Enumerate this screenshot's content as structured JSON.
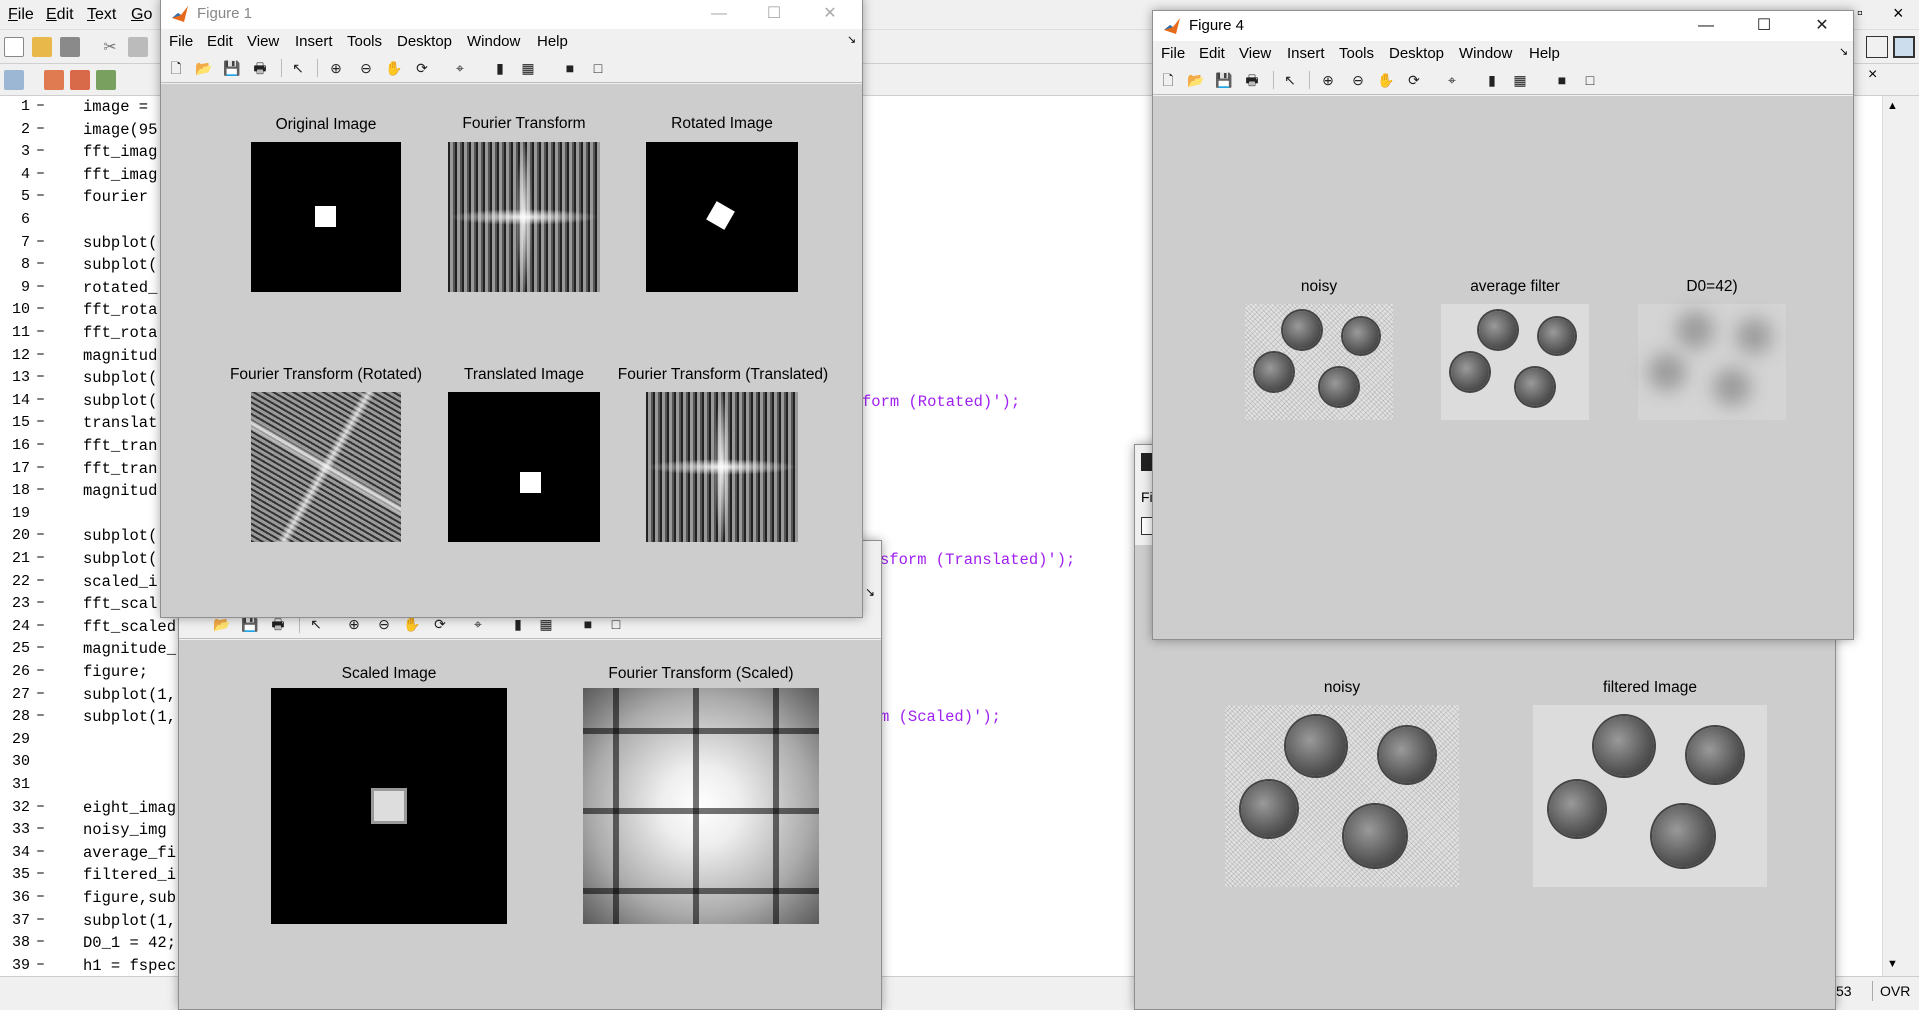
{
  "editor": {
    "menu": [
      "File",
      "Edit",
      "Text",
      "Go"
    ],
    "lines": [
      {
        "n": "1",
        "code": "image ="
      },
      {
        "n": "2",
        "code": "image(95"
      },
      {
        "n": "3",
        "code": "fft_imag"
      },
      {
        "n": "4",
        "code": "fft_imag"
      },
      {
        "n": "5",
        "code": "fourier"
      },
      {
        "n": "6",
        "code": ""
      },
      {
        "n": "7",
        "code": "subplot("
      },
      {
        "n": "8",
        "code": "subplot("
      },
      {
        "n": "9",
        "code": "rotated_"
      },
      {
        "n": "10",
        "code": "fft_rota"
      },
      {
        "n": "11",
        "code": "fft_rota"
      },
      {
        "n": "12",
        "code": "magnitud"
      },
      {
        "n": "13",
        "code": "subplot("
      },
      {
        "n": "14",
        "code": "subplot("
      },
      {
        "n": "15",
        "code": "translat"
      },
      {
        "n": "16",
        "code": "fft_tran"
      },
      {
        "n": "17",
        "code": "fft_tran"
      },
      {
        "n": "18",
        "code": "magnitud"
      },
      {
        "n": "19",
        "code": ""
      },
      {
        "n": "20",
        "code": "subplot("
      },
      {
        "n": "21",
        "code": "subplot("
      },
      {
        "n": "22",
        "code": "scaled_i"
      },
      {
        "n": "23",
        "code": "fft_scal"
      },
      {
        "n": "24",
        "code": "fft_scaled"
      },
      {
        "n": "25",
        "code": "magnitude_"
      },
      {
        "n": "26",
        "code": "figure;"
      },
      {
        "n": "27",
        "code": "subplot(1,"
      },
      {
        "n": "28",
        "code": "subplot(1,"
      },
      {
        "n": "29",
        "code": ""
      },
      {
        "n": "30",
        "code": ""
      },
      {
        "n": "31",
        "code": ""
      },
      {
        "n": "32",
        "code": "eight_imag"
      },
      {
        "n": "33",
        "code": "noisy_img"
      },
      {
        "n": "34",
        "code": "average_fi"
      },
      {
        "n": "35",
        "code": "filtered_i"
      },
      {
        "n": "36",
        "code": "figure,sub"
      },
      {
        "n": "37",
        "code": "subplot(1,"
      },
      {
        "n": "38",
        "code": "D0_1 = 42;"
      },
      {
        "n": "39",
        "code": "h1 = fspec"
      }
    ],
    "visible_string_14": "form (Rotated)');",
    "visible_string_21": "sform (Translated)');",
    "visible_string_28": "m (Scaled)');",
    "status_col": "53",
    "status_mode": "OVR"
  },
  "figure1": {
    "title": "Figure 1",
    "menu": [
      "File",
      "Edit",
      "View",
      "Insert",
      "Tools",
      "Desktop",
      "Window",
      "Help"
    ],
    "axes_titles": [
      "Original Image",
      "Fourier Transform",
      "Rotated Image",
      "Fourier Transform (Rotated)",
      "Translated Image",
      "Fourier Transform (Translated)"
    ]
  },
  "figure_scaled": {
    "axes_titles": [
      "Scaled Image",
      "Fourier Transform (Scaled)"
    ]
  },
  "figure4": {
    "title": "Figure 4",
    "menu": [
      "File",
      "Edit",
      "View",
      "Insert",
      "Tools",
      "Desktop",
      "Window",
      "Help"
    ],
    "axes_titles": [
      "noisy",
      "average filter",
      "D0=42)"
    ]
  },
  "figure_filtered": {
    "axes_titles": [
      "noisy",
      "filtered Image"
    ]
  },
  "colors": {
    "string": "#a020f0",
    "canvas": "#cdcdcd",
    "chrome": "#f0f0f0"
  }
}
